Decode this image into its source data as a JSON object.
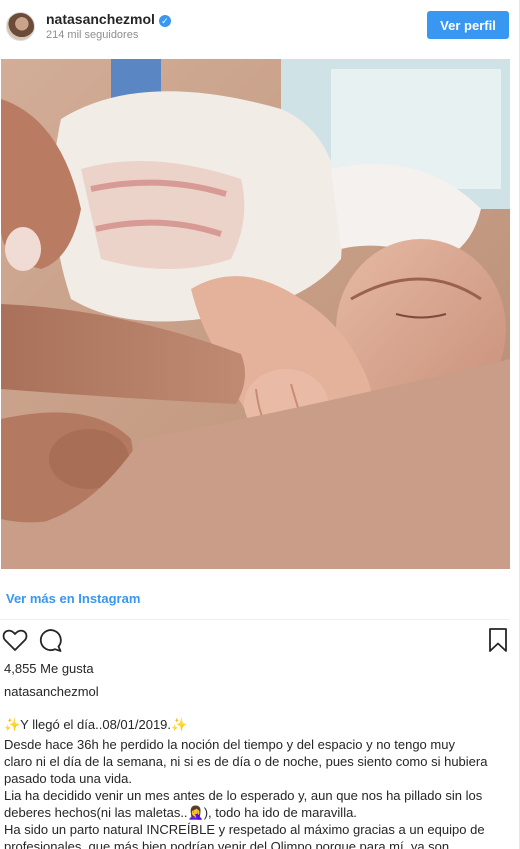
{
  "header": {
    "username": "natasanchezmol",
    "verified_mark": "✓",
    "followers": "214 mil seguidores",
    "view_profile_label": "Ver perfil"
  },
  "post": {
    "image_alt": "Newborn baby holding a finger",
    "view_more_label": "Ver más en Instagram",
    "likes": "4,855 Me gusta",
    "caption_user": "natasanchezmol",
    "caption_title": "✨Y llegó el día..08/01/2019.✨",
    "caption_lines": [
      "Desde hace 36h he perdido la noción del tiempo y del espacio y no tengo muy",
      "claro ni el día de la semana, ni si es de día o de noche, pues siento como si hubiera",
      "pasado toda una vida.",
      "Lia ha decidido venir un mes antes de lo esperado y, aun que nos ha pillado sin los",
      "deberes hechos(ni las maletas..🤦‍♀️), todo ha ido de maravilla.",
      "Ha sido un parto natural INCREÍBLE y respetado al máximo gracias a un equipo de",
      "profesionales, que más bien podrían venir del Olimpo porque para mí, ya son"
    ]
  },
  "icons": {
    "like": "heart-icon",
    "comment": "comment-icon",
    "save": "bookmark-icon",
    "verified": "verified-badge-icon"
  },
  "colors": {
    "accent": "#3897f0",
    "text": "#262626",
    "muted": "#8e8e8e"
  }
}
